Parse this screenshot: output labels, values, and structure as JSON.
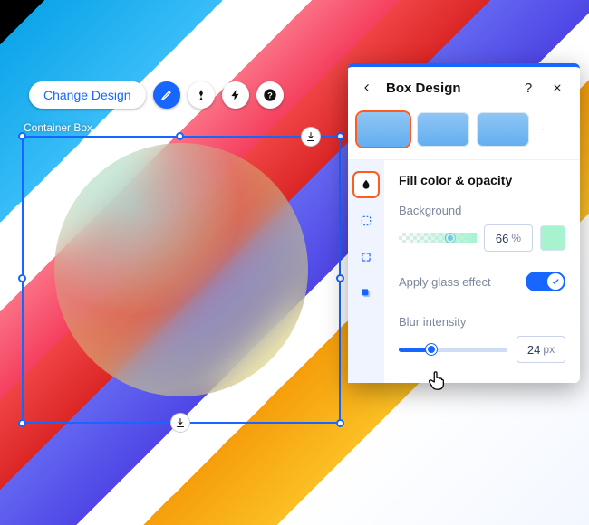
{
  "toolbar": {
    "change_design_label": "Change Design"
  },
  "canvas": {
    "selected_element_label": "Container Box"
  },
  "panel": {
    "title": "Box Design",
    "style_thumbs": {
      "selected_index": 0,
      "count": 3
    },
    "side_tabs": {
      "selected_index": 0
    },
    "section_title": "Fill color & opacity",
    "background": {
      "label": "Background",
      "opacity_value": "66",
      "opacity_unit": "%",
      "opacity_ratio": 0.66,
      "swatch_color": "#a7f3d0"
    },
    "glass_toggle": {
      "label": "Apply glass effect",
      "on": true
    },
    "blur": {
      "label": "Blur intensity",
      "value": "24",
      "unit": "px",
      "max": 100,
      "ratio": 0.3
    }
  }
}
